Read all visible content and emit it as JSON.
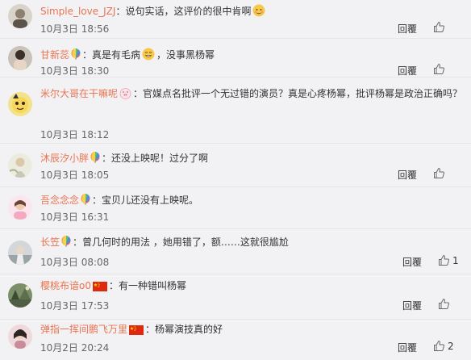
{
  "colors": {
    "name": "#eb7350",
    "text": "#333333",
    "time": "#666666",
    "background": "#f2f2f5"
  },
  "comments": [
    {
      "name": "Simple_love_JZJ",
      "badge": "none",
      "text": "：说句实话，这评价的很中肯啊",
      "emoji": "shy-face-emoji",
      "time": "10月3日 18:56",
      "reply": "回覆",
      "likes": ""
    },
    {
      "name": "甘新蕊",
      "badge": "rainbow-balloon-icon",
      "text": "：真是有毛病",
      "emoji": "grin-face-emoji",
      "text2": "，没事黑杨幂",
      "time": "10月3日 18:30",
      "reply": "回覆",
      "likes": ""
    },
    {
      "name": "米尔大哥在干嘛呢",
      "badge": "pig-icon",
      "text": "：官媒点名批评一个无过错的演员？真是心疼杨幂，批评杨幂是政治正确吗？",
      "time": "10月3日 18:12",
      "reply": "回覆",
      "likes": ""
    },
    {
      "name": "沐辰汐小胖",
      "badge": "rainbow-balloon-icon",
      "text": "：还没上映呢！过分了啊",
      "time": "10月3日 18:05",
      "reply": "回覆",
      "likes": ""
    },
    {
      "name": "吾念念念",
      "badge": "rainbow-balloon-icon",
      "text": "：宝贝儿还没有上映呢。",
      "time": "10月3日 16:31",
      "reply": "回覆",
      "likes": ""
    },
    {
      "name": "长笠",
      "badge": "rainbow-balloon-icon",
      "text": "：曾几何时的用法 ，她用错了，额……这就很尴尬",
      "time": "10月3日 08:08",
      "reply": "回覆",
      "likes": "1"
    },
    {
      "name": "樱桃布谙o0",
      "badge": "china-flag-icon",
      "text": "：有一种错叫杨幂",
      "time": "10月3日 17:53",
      "reply": "回覆",
      "likes": ""
    },
    {
      "name": "弹指一挥间鹏飞万里",
      "badge": "china-flag-icon",
      "text": "：杨幂演技真的好",
      "time": "10月2日 20:24",
      "reply": "回覆",
      "likes": "2"
    }
  ]
}
